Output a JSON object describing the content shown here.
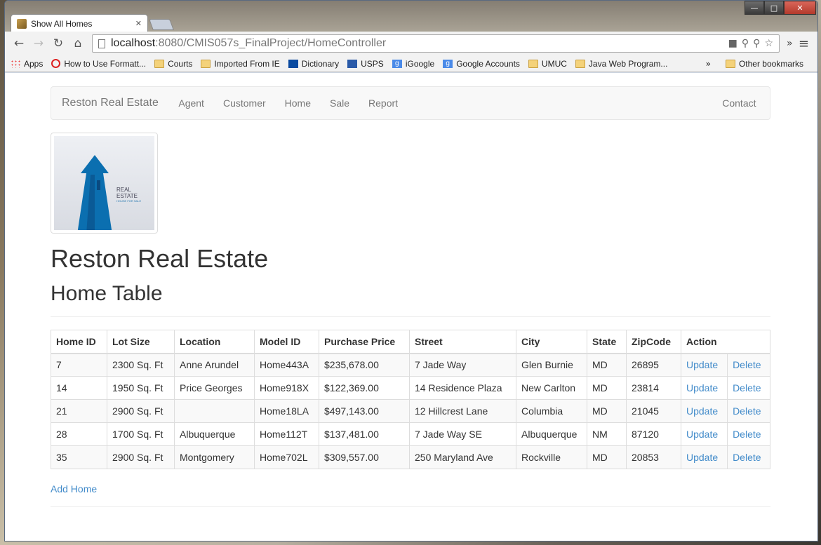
{
  "browser": {
    "tab_title": "Show All Homes",
    "url_host": "localhost",
    "url_path": ":8080/CMIS057s_FinalProject/HomeController",
    "bookmarks": [
      {
        "label": "Apps",
        "icon": "apps-grid-icon"
      },
      {
        "label": "How to Use Formatt...",
        "icon": "opera-icon"
      },
      {
        "label": "Courts",
        "icon": "folder-icon"
      },
      {
        "label": "Imported From IE",
        "icon": "folder-icon"
      },
      {
        "label": "Dictionary",
        "icon": "dictionary-icon"
      },
      {
        "label": "USPS",
        "icon": "usps-icon"
      },
      {
        "label": "iGoogle",
        "icon": "google-icon"
      },
      {
        "label": "Google Accounts",
        "icon": "google-icon"
      },
      {
        "label": "UMUC",
        "icon": "folder-icon"
      },
      {
        "label": "Java Web Program...",
        "icon": "folder-icon"
      }
    ],
    "bookmarks_more": "»",
    "other_bookmarks": "Other bookmarks"
  },
  "navbar": {
    "brand": "Reston Real Estate",
    "links": [
      "Agent",
      "Customer",
      "Home",
      "Sale",
      "Report"
    ],
    "right_link": "Contact"
  },
  "logo": {
    "line1": "REAL",
    "line2": "ESTATE",
    "line3": "HOUSE FOR SALE"
  },
  "page_title": "Reston Real Estate",
  "table_title": "Home Table",
  "table": {
    "headers": [
      "Home ID",
      "Lot Size",
      "Location",
      "Model ID",
      "Purchase Price",
      "Street",
      "City",
      "State",
      "ZipCode",
      "Action"
    ],
    "rows": [
      {
        "id": "7",
        "lot": "2300 Sq. Ft",
        "location": "Anne Arundel",
        "model": "Home443A",
        "price": "$235,678.00",
        "street": "7 Jade Way",
        "city": "Glen Burnie",
        "state": "MD",
        "zip": "26895",
        "update": "Update",
        "delete": "Delete"
      },
      {
        "id": "14",
        "lot": "1950 Sq. Ft",
        "location": "Price Georges",
        "model": "Home918X",
        "price": "$122,369.00",
        "street": "14 Residence Plaza",
        "city": "New Carlton",
        "state": "MD",
        "zip": "23814",
        "update": "Update",
        "delete": "Delete"
      },
      {
        "id": "21",
        "lot": "2900 Sq. Ft",
        "location": "",
        "model": "Home18LA",
        "price": "$497,143.00",
        "street": "12 Hillcrest Lane",
        "city": "Columbia",
        "state": "MD",
        "zip": "21045",
        "update": "Update",
        "delete": "Delete"
      },
      {
        "id": "28",
        "lot": "1700 Sq. Ft",
        "location": "Albuquerque",
        "model": "Home112T",
        "price": "$137,481.00",
        "street": "7 Jade Way SE",
        "city": "Albuquerque",
        "state": "NM",
        "zip": "87120",
        "update": "Update",
        "delete": "Delete"
      },
      {
        "id": "35",
        "lot": "2900 Sq. Ft",
        "location": "Montgomery",
        "model": "Home702L",
        "price": "$309,557.00",
        "street": "250 Maryland Ave",
        "city": "Rockville",
        "state": "MD",
        "zip": "20853",
        "update": "Update",
        "delete": "Delete"
      }
    ]
  },
  "add_link": "Add Home",
  "colors": {
    "link": "#428bca",
    "navbar_bg": "#f8f8f8",
    "text": "#333333"
  }
}
